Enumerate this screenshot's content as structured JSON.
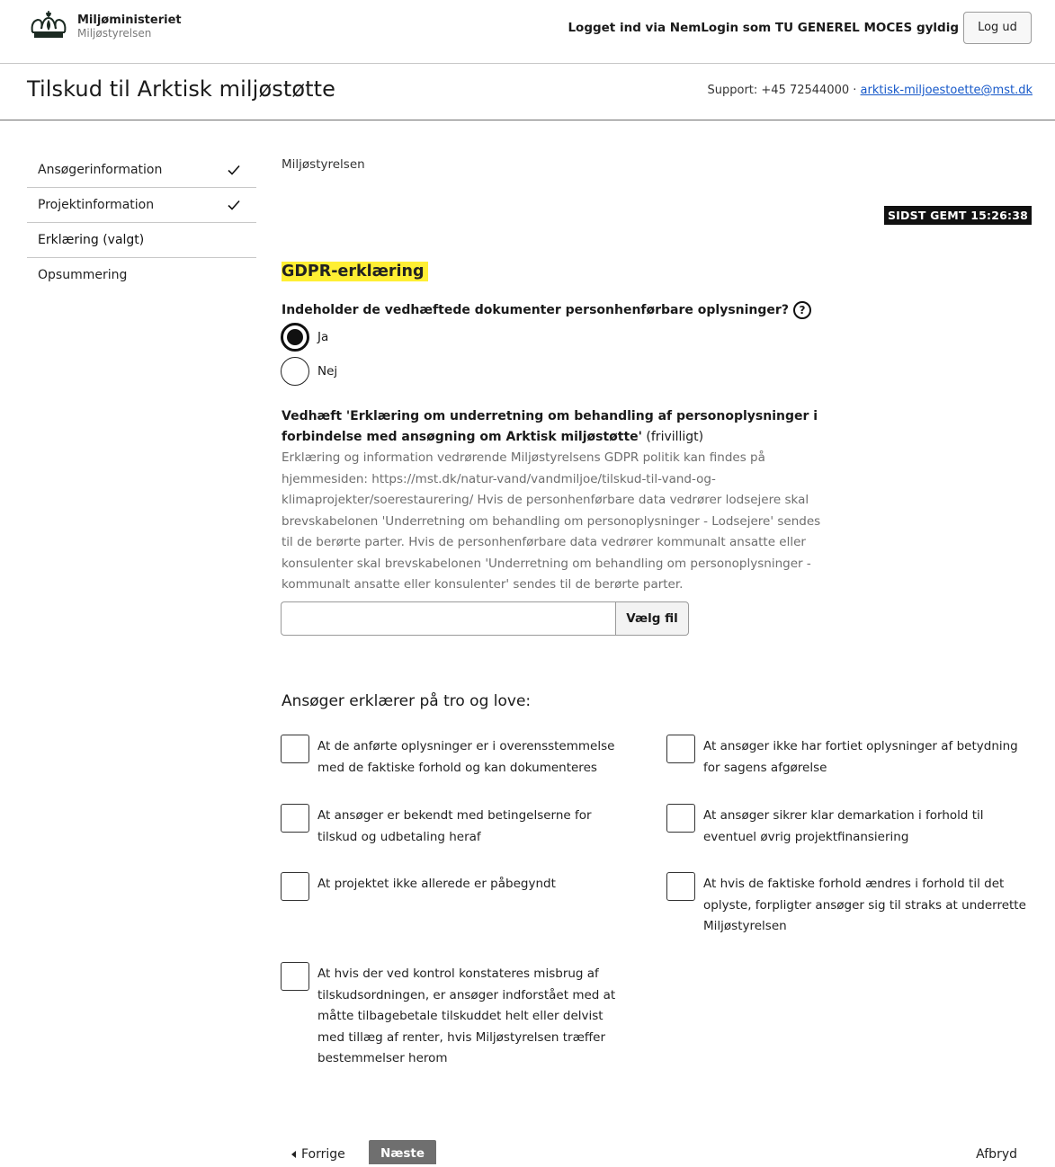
{
  "header": {
    "logo_title": "Miljøministeriet",
    "logo_subtitle": "Miljøstyrelsen",
    "login_status": "Logget ind via NemLogin som TU GENEREL MOCES gyldig",
    "logout_label": "Log ud"
  },
  "titlebar": {
    "title": "Tilskud til Arktisk miljøstøtte",
    "support_prefix": "Support: +45 72544000 · ",
    "support_email": "arktisk-miljoestoette@mst.dk"
  },
  "sidebar": {
    "items": [
      {
        "label": "Ansøgerinformation",
        "completed": true
      },
      {
        "label": "Projektinformation",
        "completed": true
      },
      {
        "label": "Erklæring (valgt)",
        "completed": false
      },
      {
        "label": "Opsummering",
        "completed": false
      }
    ]
  },
  "main": {
    "breadcrumb": "Miljøstyrelsen",
    "saved_badge": "SIDST GEMT 15:26:38",
    "gdpr_title": "GDPR-erklæring",
    "question": "Indeholder de vedhæftede dokumenter personhenførbare oplysninger?",
    "help_glyph": "?",
    "radios": [
      {
        "label": "Ja",
        "selected": true
      },
      {
        "label": "Nej",
        "selected": false
      }
    ],
    "attach_title": "Vedhæft 'Erklæring om underretning om behandling af personoplysninger i forbindelse med ansøgning om Arktisk miljøstøtte'",
    "attach_optional": " (frivilligt)",
    "attach_description": "Erklæring og information vedrørende Miljøstyrelsens GDPR politik kan findes på hjemmesiden: https://mst.dk/natur-vand/vandmiljoe/tilskud-til-vand-og-klimaprojekter/soerestaurering/ Hvis de personhenførbare data vedrører lodsejere skal brevskabelonen 'Underretning om behandling om personoplysninger - Lodsejere' sendes til de berørte parter. Hvis de personhenførbare data vedrører kommunalt ansatte eller konsulenter skal brevskabelonen 'Underretning om behandling om personoplysninger - kommunalt ansatte eller konsulenter' sendes til de berørte parter.",
    "file_value": "",
    "file_button": "Vælg fil",
    "declare_title": "Ansøger erklærer på tro og love:",
    "declarations": [
      "At de anførte oplysninger er i overensstemmelse med de faktiske forhold og kan dokumenteres",
      "At ansøger ikke har fortiet oplysninger af betydning for sagens afgørelse",
      "At ansøger er bekendt med betingelserne for tilskud og udbetaling heraf",
      "At ansøger sikrer klar demarkation i forhold til eventuel øvrig projektfinansiering",
      "At projektet ikke allerede er påbegyndt",
      "At hvis de faktiske forhold ændres i forhold til det oplyste, forpligter ansøger sig til straks at underrette Miljøstyrelsen",
      "At hvis der ved kontrol konstateres misbrug af tilskudsordningen, er ansøger indforstået med at måtte tilbagebetale tilskuddet helt eller delvist med tillæg af renter, hvis Miljøstyrelsen træffer bestemmelser herom"
    ]
  },
  "footer_nav": {
    "prev_label": "Forrige",
    "next_label": "Næste",
    "cancel_label": "Afbryd"
  },
  "colors": {
    "highlight": "#ffef33",
    "link": "#1658c9",
    "badge_bg": "#111111",
    "next_button_bg": "#6f6f6f"
  }
}
